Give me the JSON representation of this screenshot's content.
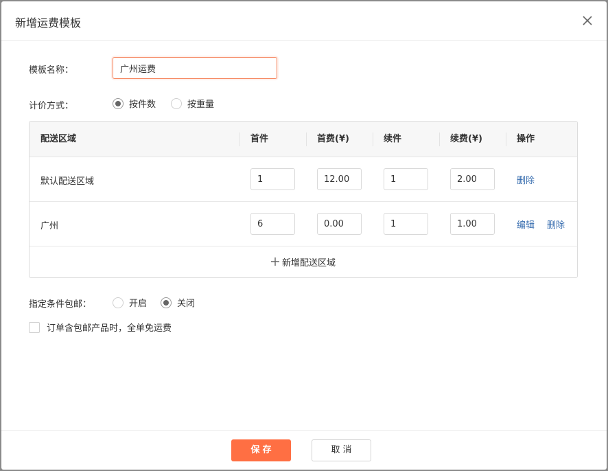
{
  "dialog": {
    "title": "新增运费模板"
  },
  "form": {
    "name_label": "模板名称：",
    "name_value": "广州运费",
    "pricing_label": "计价方式：",
    "pricing_options": [
      "按件数",
      "按重量"
    ],
    "pricing_selected": "按件数",
    "free_shipping_label": "指定条件包邮：",
    "free_shipping_options": [
      "开启",
      "关闭"
    ],
    "free_shipping_selected": "关闭",
    "checkbox_label": "订单含包邮产品时，全单免运费",
    "checkbox_checked": false
  },
  "table": {
    "headers": [
      "配送区域",
      "首件",
      "首费(¥)",
      "续件",
      "续费(¥)",
      "操作"
    ],
    "rows": [
      {
        "region": "默认配送区域",
        "first_item": "1",
        "first_fee": "12.00",
        "extra_item": "1",
        "extra_fee": "2.00",
        "actions": [
          "删除"
        ]
      },
      {
        "region": "广州",
        "first_item": "6",
        "first_fee": "0.00",
        "extra_item": "1",
        "extra_fee": "1.00",
        "actions": [
          "编辑",
          "删除"
        ]
      }
    ],
    "add_label": "新增配送区域"
  },
  "footer": {
    "save_label": "保存",
    "cancel_label": "取消"
  },
  "colors": {
    "accent": "#ff6f43",
    "link": "#3a6fb0"
  },
  "icons": [
    "close-icon",
    "plus-icon"
  ]
}
